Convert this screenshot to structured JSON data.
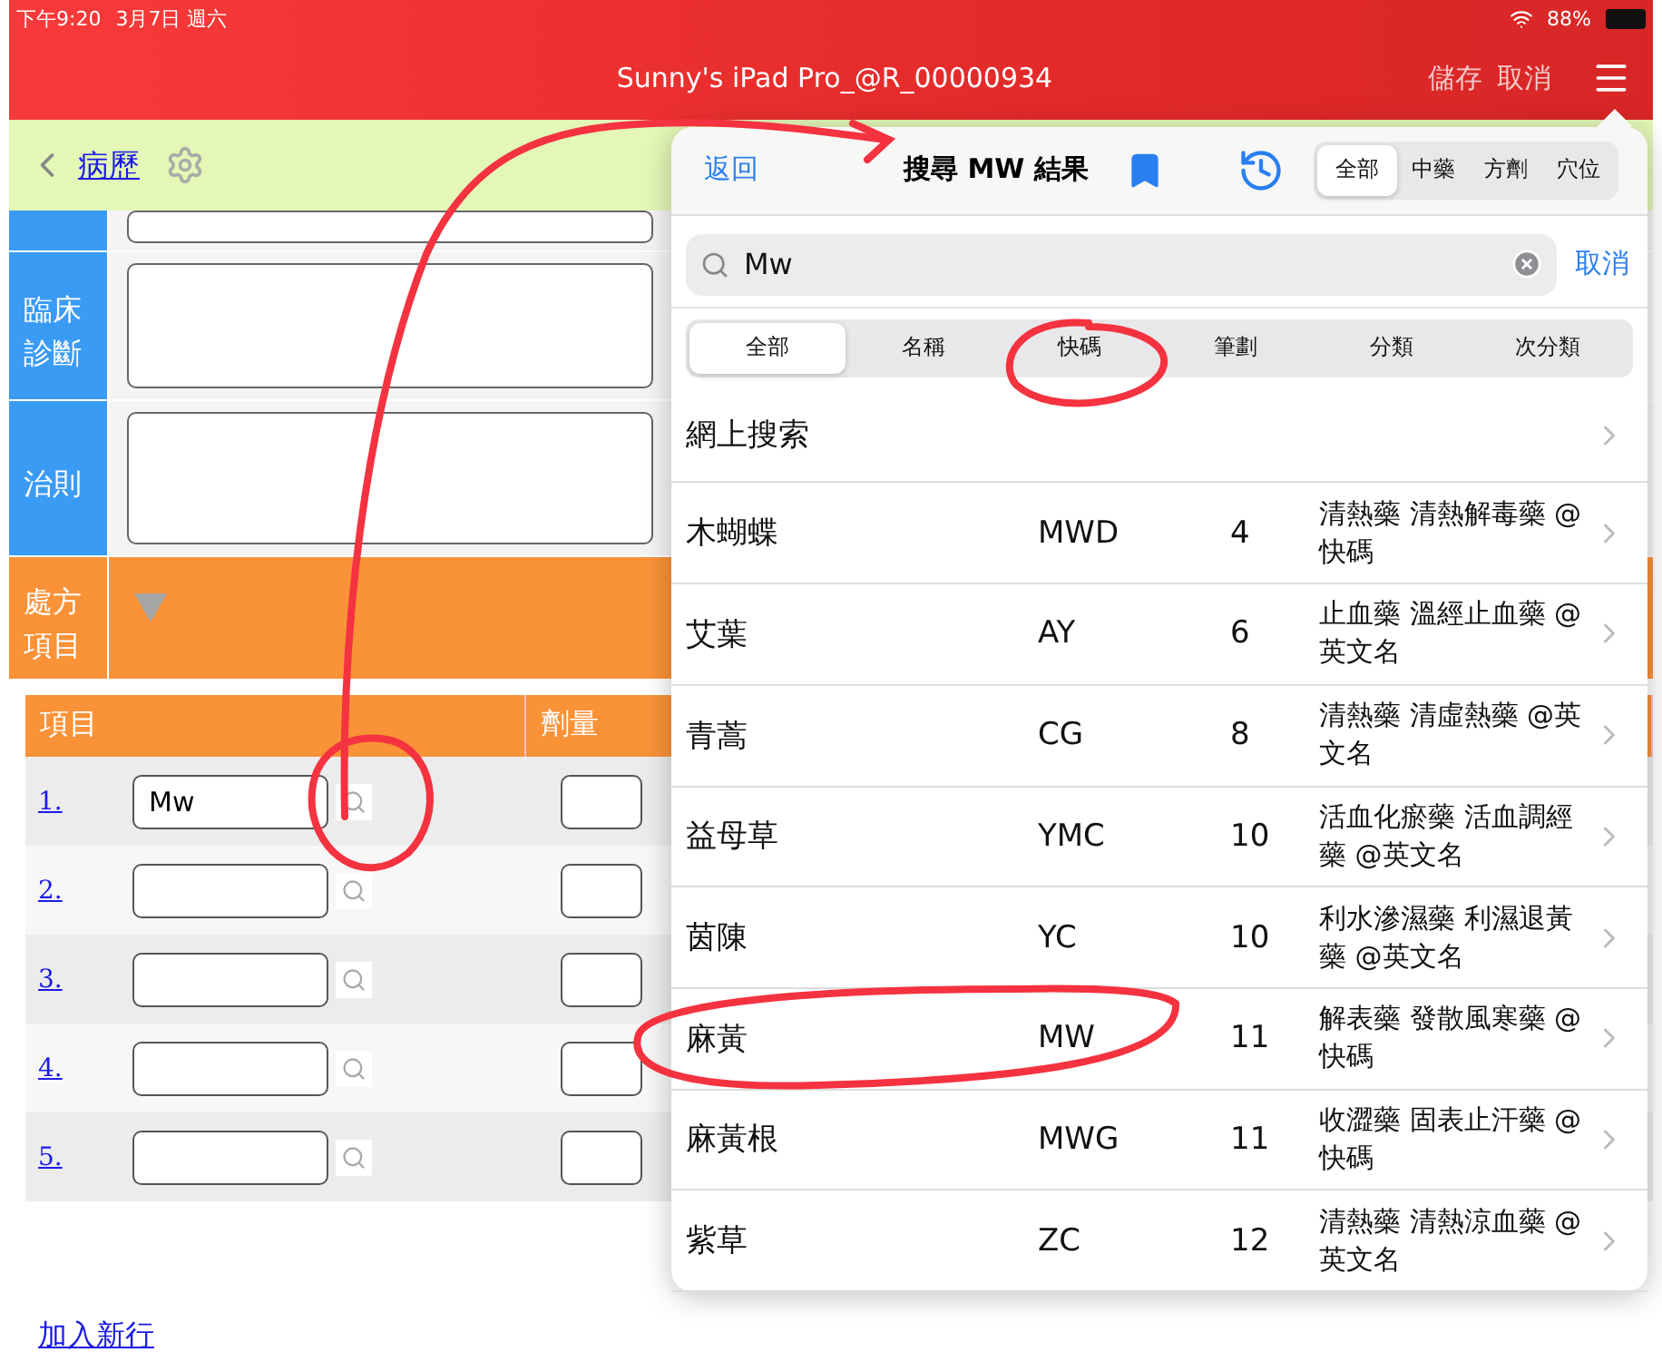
{
  "status_bar": {
    "time": "下午9:20",
    "date": "3月7日 週六",
    "battery": "88%"
  },
  "header": {
    "title": "Sunny's iPad Pro_@R_00000934",
    "actions": [
      "儲存",
      "取消"
    ]
  },
  "sub_bar": {
    "back": "病歷"
  },
  "form": {
    "fields": [
      {
        "label": "臨床診斷"
      },
      {
        "label": "治則"
      }
    ],
    "section": "處方項目"
  },
  "table": {
    "columns": [
      "項目",
      "劑量"
    ],
    "rows": [
      {
        "index": "1.",
        "value": "Mw"
      },
      {
        "index": "2."
      },
      {
        "index": "3."
      },
      {
        "index": "4."
      },
      {
        "index": "5."
      }
    ],
    "add_row": "加入新行"
  },
  "popover": {
    "back": "返回",
    "title": "搜尋 MW 結果",
    "scopes": [
      {
        "label": "全部",
        "selected": true
      },
      {
        "label": "中藥",
        "selected": false
      },
      {
        "label": "方劑",
        "selected": false
      },
      {
        "label": "穴位",
        "selected": false
      }
    ],
    "search": {
      "value": "Mw"
    },
    "cancel": "取消",
    "filters": [
      {
        "label": "全部",
        "selected": true
      },
      {
        "label": "名稱",
        "selected": false
      },
      {
        "label": "快碼",
        "selected": false
      },
      {
        "label": "筆劃",
        "selected": false
      },
      {
        "label": "分類",
        "selected": false
      },
      {
        "label": "次分類",
        "selected": false
      }
    ],
    "web_search": "網上搜索",
    "results": [
      {
        "name": "木蝴蝶",
        "code": "MWD",
        "strokes": "4",
        "category": "清熱藥 清熱解毒藥 @快碼"
      },
      {
        "name": "艾葉",
        "code": "AY",
        "strokes": "6",
        "category": "止血藥 溫經止血藥 @英文名"
      },
      {
        "name": "青蒿",
        "code": "CG",
        "strokes": "8",
        "category": "清熱藥 清虛熱藥 @英文名"
      },
      {
        "name": "益母草",
        "code": "YMC",
        "strokes": "10",
        "category": "活血化瘀藥 活血調經藥 @英文名"
      },
      {
        "name": "茵陳",
        "code": "YC",
        "strokes": "10",
        "category": "利水滲濕藥 利濕退黃藥 @英文名"
      },
      {
        "name": "麻黃",
        "code": "MW",
        "strokes": "11",
        "category": "解表藥 發散風寒藥 @快碼"
      },
      {
        "name": "麻黃根",
        "code": "MWG",
        "strokes": "11",
        "category": "收澀藥 固表止汗藥 @快碼"
      },
      {
        "name": "紫草",
        "code": "ZC",
        "strokes": "12",
        "category": "清熱藥 清熱涼血藥 @英文名"
      }
    ]
  }
}
